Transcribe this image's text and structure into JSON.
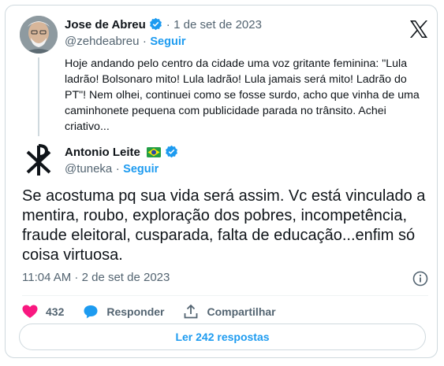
{
  "quoted": {
    "name": "Jose de Abreu",
    "handle": "@zehdeabreu",
    "separator": "·",
    "date": "1 de set de 2023",
    "follow_label": "Seguir",
    "text": "Hoje andando pelo centro da cidade uma voz gritante feminina: \"Lula ladrão! Bolsonaro mito! Lula ladrão! Lula jamais será mito! Ladrão do PT\"! Nem olhei, continuei como se fosse surdo, acho que vinha de uma caminhonete pequena com publicidade parada no trânsito. Achei criativo..."
  },
  "reply": {
    "name": "Antonio Leite",
    "handle": "@tuneka",
    "separator": "·",
    "follow_label": "Seguir",
    "text": "Se acostuma pq sua vida será assim. Vc está vinculado a mentira, roubo, exploração dos pobres, incompetência, fraude eleitoral, cusparada, falta de educação...enfim só coisa virtuosa.",
    "timestamp": "11:04 AM · 2 de set de 2023"
  },
  "actions": {
    "likes": "432",
    "reply_label": "Responder",
    "share_label": "Compartilhar"
  },
  "read_replies_label": "Ler 242 respostas",
  "icons": {
    "brand": "x-logo-icon",
    "verified": "verified-badge-icon",
    "flag": "brazil-flag-icon",
    "like": "heart-icon",
    "reply": "speech-bubble-icon",
    "share": "share-upload-icon",
    "info": "info-icon"
  },
  "colors": {
    "accent": "#1d9bf0",
    "like": "#f91880",
    "muted": "#536471",
    "text": "#0f1419"
  }
}
